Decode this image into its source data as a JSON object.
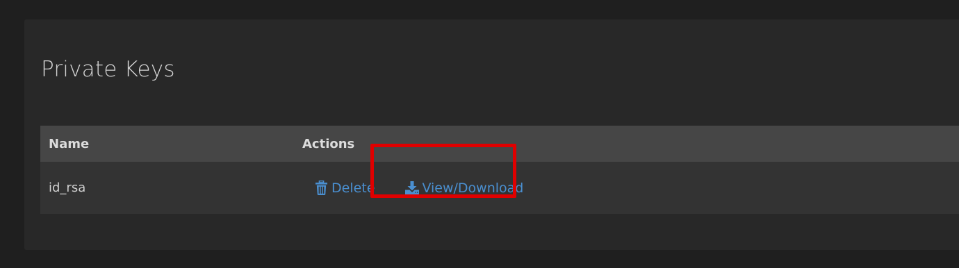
{
  "page": {
    "title": "Private Keys"
  },
  "table": {
    "columns": [
      "Name",
      "Actions"
    ],
    "rows": [
      {
        "name": "id_rsa",
        "actions": {
          "delete_label": "Delete",
          "delete_icon": "trash-icon",
          "view_label": "View/Download",
          "view_icon": "download-icon"
        }
      }
    ]
  },
  "colors": {
    "background": "#1f1f1f",
    "panel": "#282828",
    "header_row": "#464646",
    "body_row": "#333333",
    "link": "#4a8fd0",
    "highlight": "#e00000"
  },
  "annotation": {
    "highlighted_action": "View/Download"
  }
}
